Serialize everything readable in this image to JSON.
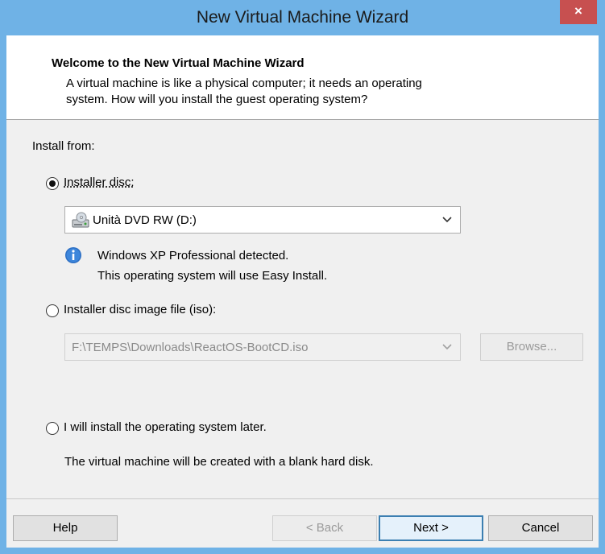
{
  "window": {
    "title": "New Virtual Machine Wizard",
    "close_glyph": "×"
  },
  "header": {
    "title": "Welcome to the New Virtual Machine Wizard",
    "description_line1": "A virtual machine is like a physical computer; it needs an operating",
    "description_line2": "system. How will you install the guest operating system?"
  },
  "install_from": {
    "label": "Install from:",
    "installer_disc": {
      "label": "Installer disc:",
      "selected": true,
      "drive_value": "Unità DVD RW (D:)",
      "drive_icon": "dvd-drive-icon",
      "info_line1": "Windows XP Professional detected.",
      "info_line2": "This operating system will use Easy Install."
    },
    "iso": {
      "label": "Installer disc image file (iso):",
      "selected": false,
      "path_value": "F:\\TEMPS\\Downloads\\ReactOS-BootCD.iso",
      "browse_label": "Browse..."
    },
    "later": {
      "label": "I will install the operating system later.",
      "selected": false,
      "note": "The virtual machine will be created with a blank hard disk."
    }
  },
  "footer": {
    "help_label": "Help",
    "back_label": "< Back",
    "next_label": "Next >",
    "cancel_label": "Cancel"
  },
  "colors": {
    "title_bar": "#6fb2e6",
    "close_button": "#c75050",
    "dialog_background": "#f0f0f0",
    "default_button_border": "#3c7fb1"
  }
}
